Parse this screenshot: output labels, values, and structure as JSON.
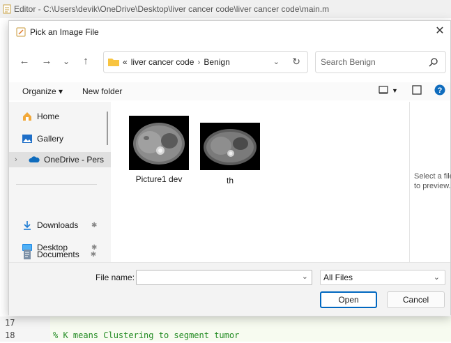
{
  "editor": {
    "title": "Editor - C:\\Users\\devik\\OneDrive\\Desktop\\liver cancer code\\liver cancer code\\main.m",
    "lines": [
      {
        "number": "17",
        "code": ""
      },
      {
        "number": "18",
        "code": "% K means Clustering to segment tumor"
      }
    ]
  },
  "dialog": {
    "title": "Pick an Image File",
    "close_label": "✕",
    "nav": {
      "back": "←",
      "forward": "→",
      "recent": "⌄",
      "up": "↑",
      "overflow": "«",
      "breadcrumbs": [
        "liver cancer code",
        "Benign"
      ],
      "separator": "›",
      "refresh": "↻"
    },
    "search": {
      "placeholder": "Search Benign"
    },
    "toolbar": {
      "organize": "Organize ▾",
      "new_folder": "New folder"
    },
    "sidebar": {
      "items": [
        {
          "label": "Home",
          "icon": "home-icon"
        },
        {
          "label": "Gallery",
          "icon": "gallery-icon"
        },
        {
          "label": "OneDrive - Pers",
          "icon": "cloud-icon"
        },
        {
          "label": "Downloads",
          "icon": "download-icon"
        },
        {
          "label": "Desktop",
          "icon": "desktop-icon"
        },
        {
          "label": "Documents",
          "icon": "documents-icon"
        }
      ],
      "pin": "✱"
    },
    "files": [
      {
        "name": "Picture1 dev"
      },
      {
        "name": "th"
      }
    ],
    "preview_text": "Select a file\nto preview.",
    "footer": {
      "file_name_label": "File name:",
      "file_name_value": "",
      "file_type": "All Files",
      "open_label": "Open",
      "cancel_label": "Cancel"
    }
  },
  "colors": {
    "accent": "#0067c0",
    "folder": "#f8c440",
    "onedrive": "#0f6cbd",
    "code_comment": "#228b22"
  }
}
